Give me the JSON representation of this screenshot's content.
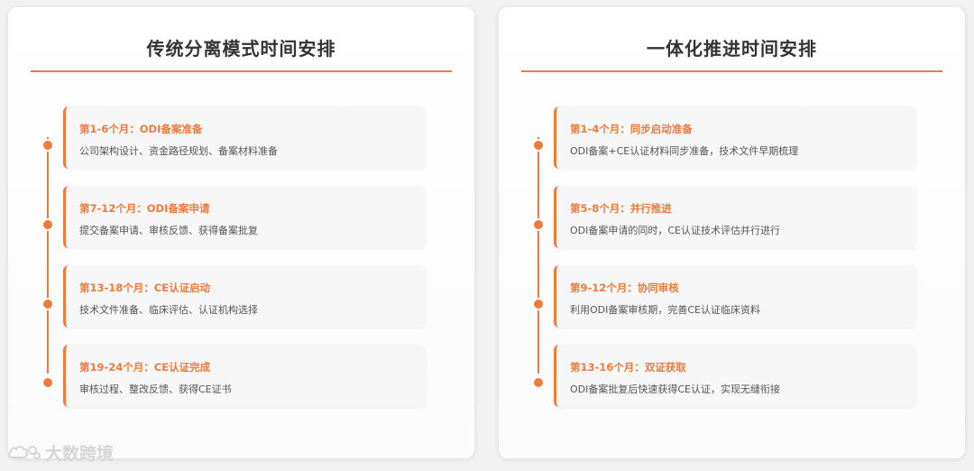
{
  "colors": {
    "accent": "#f07a3c",
    "title": "#333333",
    "text": "#555555"
  },
  "panels": [
    {
      "title": "传统分离模式时间安排",
      "items": [
        {
          "title": "第1-6个月：ODI备案准备",
          "desc": "公司架构设计、资金路径规划、备案材料准备"
        },
        {
          "title": "第7-12个月：ODI备案申请",
          "desc": "提交备案申请、审核反馈、获得备案批复"
        },
        {
          "title": "第13-18个月：CE认证启动",
          "desc": "技术文件准备、临床评估、认证机构选择"
        },
        {
          "title": "第19-24个月：CE认证完成",
          "desc": "审核过程、整改反馈、获得CE证书"
        }
      ]
    },
    {
      "title": "一体化推进时间安排",
      "items": [
        {
          "title": "第1-4个月：同步启动准备",
          "desc": "ODI备案+CE认证材料同步准备，技术文件早期梳理"
        },
        {
          "title": "第5-8个月：并行推进",
          "desc": "ODI备案申请的同时，CE认证技术评估并行进行"
        },
        {
          "title": "第9-12个月：协同审核",
          "desc": "利用ODI备案审核期，完善CE认证临床资料"
        },
        {
          "title": "第13-16个月：双证获取",
          "desc": "ODI备案批复后快速获得CE认证，实现无缝衔接"
        }
      ]
    }
  ],
  "watermark": {
    "text": "大数跨境",
    "logo_icon": "cloud-logo-icon"
  }
}
